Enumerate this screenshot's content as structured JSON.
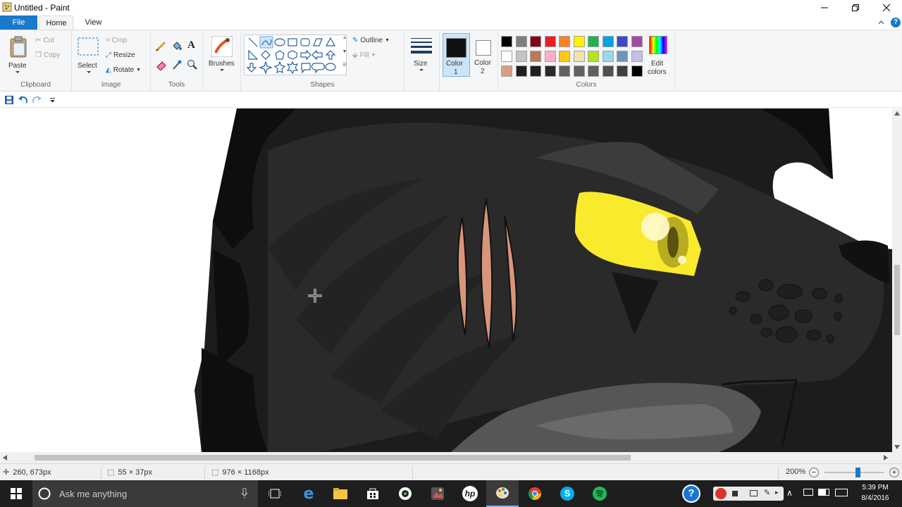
{
  "window": {
    "title": "Untitled - Paint",
    "controls": [
      "minimize",
      "restore",
      "close"
    ]
  },
  "tabs": {
    "file": "File",
    "home": "Home",
    "view": "View"
  },
  "ribbon": {
    "clipboard": {
      "label": "Clipboard",
      "paste": "Paste",
      "cut": "Cut",
      "copy": "Copy"
    },
    "image": {
      "label": "Image",
      "select": "Select",
      "crop": "Crop",
      "resize": "Resize",
      "rotate": "Rotate"
    },
    "tools": {
      "label": "Tools"
    },
    "brushes": {
      "label": "Brushes"
    },
    "shapes": {
      "label": "Shapes",
      "outline": "Outline",
      "fill": "Fill"
    },
    "size": {
      "label": "Size"
    },
    "color1": {
      "label_line1": "Color",
      "label_line2": "1",
      "value": "#111111"
    },
    "color2": {
      "label_line1": "Color",
      "label_line2": "2",
      "value": "#ffffff"
    },
    "colors": {
      "label": "Colors",
      "row1": [
        "#000000",
        "#7f7f7f",
        "#880015",
        "#ed1c24",
        "#ff7f27",
        "#fff200",
        "#22b14c",
        "#00a2e8",
        "#3f48cc",
        "#a349a4"
      ],
      "row2": [
        "#ffffff",
        "#c3c3c3",
        "#b97a57",
        "#ffaec9",
        "#ffc90e",
        "#efe4b0",
        "#b5e61d",
        "#99d9ea",
        "#7092be",
        "#c8bfe7"
      ],
      "row3": [
        "#d9a080",
        "#1f1f1f",
        "#1f1f1f",
        "#2a2a2a",
        "#606060",
        "#606060",
        "#606060",
        "#505050",
        "#404040",
        "#000000"
      ]
    },
    "edit_colors": {
      "line1": "Edit",
      "line2": "colors"
    }
  },
  "status": {
    "cursor_pos": "260, 673px",
    "selection_size": "55 × 37px",
    "image_size": "976 × 1168px",
    "zoom": "200%",
    "zoom_level": 0.56
  },
  "taskbar": {
    "search_placeholder": "Ask me anything",
    "time": "5:39 PM",
    "date": "8/4/2016"
  }
}
